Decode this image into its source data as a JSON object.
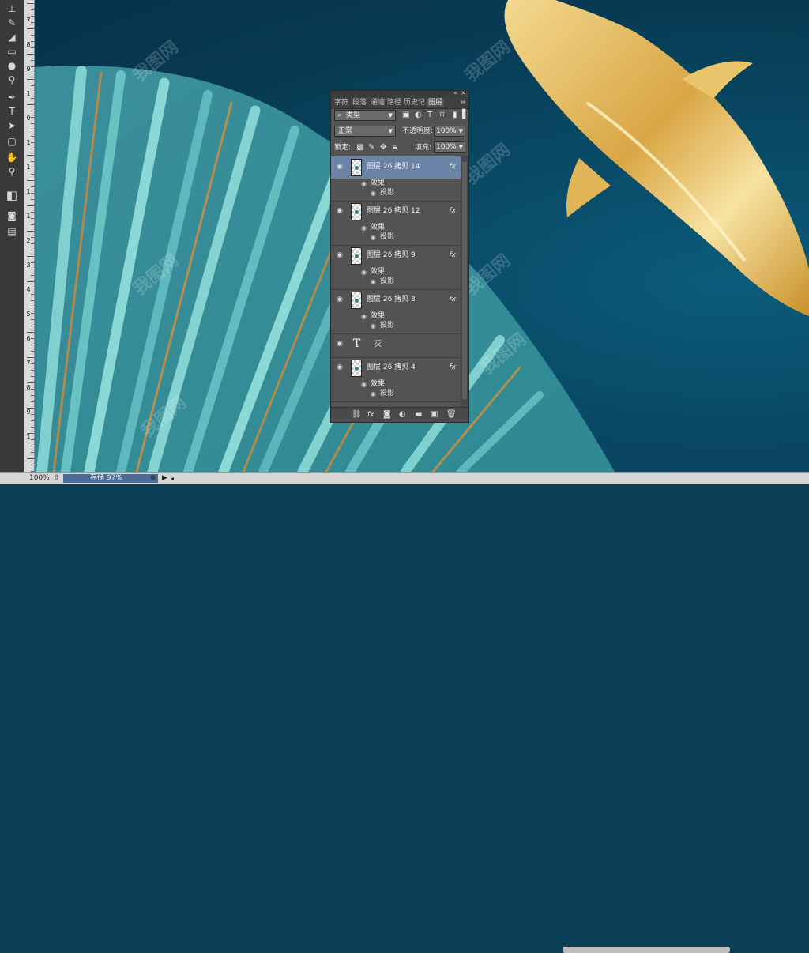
{
  "toolbar": {
    "tools": [
      "type-tool-icon",
      "brush-tool-icon",
      "eraser-icon",
      "rectangle-tool-icon",
      "blur-icon",
      "dodge-icon",
      "pen-tool-icon",
      "text-tool-icon",
      "path-select-icon",
      "shape-tool-icon",
      "hand-tool-icon",
      "zoom-tool-icon"
    ],
    "text_tool_glyph": "T"
  },
  "ruler": {
    "labels": [
      "7",
      "8",
      "9",
      "1",
      "0",
      "1",
      "1",
      "1",
      "1",
      "2",
      "3",
      "4",
      "5",
      "6",
      "7",
      "8",
      "9",
      "1"
    ]
  },
  "watermark": "我图网",
  "layers_panel": {
    "tabs": [
      "字符",
      "段落",
      "通道",
      "路径",
      "历史记",
      "图层"
    ],
    "active_tab": "图层",
    "filter_label": "类型",
    "blend_mode": "正常",
    "opacity_label": "不透明度:",
    "opacity_value": "100%",
    "lock_label": "锁定:",
    "fill_label": "填充:",
    "fill_value": "100%",
    "layers": [
      {
        "name": "图层 26 拷贝 14",
        "fx": "fx",
        "effects_label": "效果",
        "effect": "投影",
        "selected": true
      },
      {
        "name": "图层 26 拷贝 12",
        "fx": "fx",
        "effects_label": "效果",
        "effect": "投影",
        "selected": false
      },
      {
        "name": "图层 26 拷贝 9",
        "fx": "fx",
        "effects_label": "效果",
        "effect": "投影",
        "selected": false
      },
      {
        "name": "图层 26 拷贝 3",
        "fx": "fx",
        "effects_label": "效果",
        "effect": "投影",
        "selected": false
      }
    ],
    "text_layer": {
      "glyph": "T",
      "name": "灭"
    },
    "last_layer": {
      "name": "图层 26 拷贝 4",
      "fx": "fx",
      "effects_label": "效果",
      "effect": "投影"
    },
    "bottom_icons": [
      "link-layers-icon",
      "fx-icon",
      "add-mask-icon",
      "adjustment-layer-icon",
      "new-group-icon",
      "new-layer-icon",
      "delete-layer-icon"
    ],
    "fx_glyph": "fx"
  },
  "status_bar": {
    "zoom": "100%",
    "doc_label": "存储 97%"
  },
  "colors": {
    "selected_layer": "#6b83a6",
    "panel_bg": "#535353",
    "canvas_bg": "#0a4a66"
  }
}
